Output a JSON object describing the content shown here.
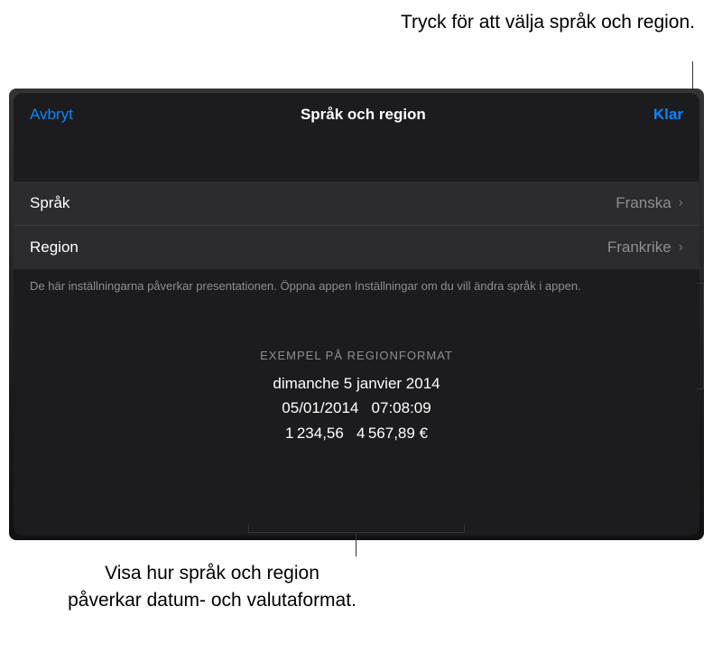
{
  "callouts": {
    "top": "Tryck för att välja språk och region.",
    "bottom": "Visa hur språk och region påverkar datum- och valutaformat."
  },
  "modal": {
    "cancel": "Avbryt",
    "title": "Språk och region",
    "done": "Klar",
    "rows": {
      "language": {
        "label": "Språk",
        "value": "Franska"
      },
      "region": {
        "label": "Region",
        "value": "Frankrike"
      }
    },
    "footer": "De här inställningarna påverkar presentationen. Öppna appen Inställningar om du vill ändra språk i appen.",
    "example": {
      "header": "EXEMPEL PÅ REGIONFORMAT",
      "line1": "dimanche 5 janvier 2014",
      "line2": "05/01/2014   07:08:09",
      "line3": "1 234,56   4 567,89 €"
    }
  }
}
